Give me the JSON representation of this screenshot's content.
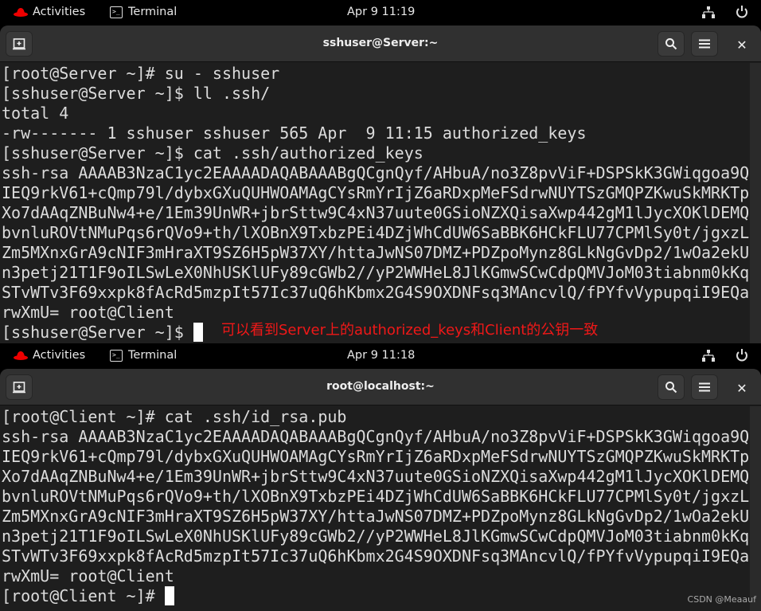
{
  "colors": {
    "annotation": "#f01818",
    "topbar": "#000000",
    "header": "#303030",
    "terminal_bg": "#1e1e1e"
  },
  "server": {
    "topbar": {
      "activities": "Activities",
      "app": "Terminal",
      "clock": "Apr 9  11:19"
    },
    "title": "sshuser@Server:~",
    "lines": [
      "[root@Server ~]# su - sshuser",
      "[sshuser@Server ~]$ ll .ssh/",
      "total 4",
      "-rw------- 1 sshuser sshuser 565 Apr  9 11:15 authorized_keys",
      "[sshuser@Server ~]$ cat .ssh/authorized_keys",
      "ssh-rsa AAAAB3NzaC1yc2EAAAADAQABAAABgQCgnQyf/AHbuA/no3Z8pvViF+DSPSkK3GWiqgoa9Q",
      "IEQ9rkV61+cQmp79l/dybxGXuQUHWOAMAgCYsRmYrIjZ6aRDxpMeFSdrwNUYTSzGMQPZKwuSkMRKTp",
      "Xo7dAAqZNBuNw4+e/1Em39UnWR+jbrSttw9C4xN37uute0GSioNZXQisaXwp442gM1lJycXOKlDEMQ",
      "bvnluROVtNMuPqs6rQVo9+th/lXOBnX9TxbzPEi4DZjWhCdUW6SaBBK6HCkFLU77CPMlSy0t/jgxzL",
      "Zm5MXnxGrA9cNIF3mHraXT9SZ6H5pW37XY/httaJwNS07DMZ+PDZpoMynz8GLkNgGvDp2/1wOa2ekU",
      "n3petj21T1F9oILSwLeX0NhUSKlUFy89cGWb2//yP2WWHeL8JlKGmwSCwCdpQMVJoM03tiabnm0kKq",
      "STvWTv3F69xxpk8fAcRd5mzpIt57Ic37uQ6hKbmx2G4S9OXDNFsq3MAncvlQ/fPYfvVypupqiI9EQa",
      "rwXmU= root@Client"
    ],
    "prompt": "[sshuser@Server ~]$ ",
    "annotation": "可以看到Server上的authorized_keys和Client的公钥一致"
  },
  "client": {
    "topbar": {
      "activities": "Activities",
      "app": "Terminal",
      "clock": "Apr 9  11:18"
    },
    "title": "root@localhost:~",
    "lines": [
      "[root@Client ~]# cat .ssh/id_rsa.pub",
      "ssh-rsa AAAAB3NzaC1yc2EAAAADAQABAAABgQCgnQyf/AHbuA/no3Z8pvViF+DSPSkK3GWiqgoa9Q",
      "IEQ9rkV61+cQmp79l/dybxGXuQUHWOAMAgCYsRmYrIjZ6aRDxpMeFSdrwNUYTSzGMQPZKwuSkMRKTp",
      "Xo7dAAqZNBuNw4+e/1Em39UnWR+jbrSttw9C4xN37uute0GSioNZXQisaXwp442gM1lJycXOKlDEMQ",
      "bvnluROVtNMuPqs6rQVo9+th/lXOBnX9TxbzPEi4DZjWhCdUW6SaBBK6HCkFLU77CPMlSy0t/jgxzL",
      "Zm5MXnxGrA9cNIF3mHraXT9SZ6H5pW37XY/httaJwNS07DMZ+PDZpoMynz8GLkNgGvDp2/1wOa2ekU",
      "n3petj21T1F9oILSwLeX0NhUSKlUFy89cGWb2//yP2WWHeL8JlKGmwSCwCdpQMVJoM03tiabnm0kKq",
      "STvWTv3F69xxpk8fAcRd5mzpIt57Ic37uQ6hKbmx2G4S9OXDNFsq3MAncvlQ/fPYfvVypupqiI9EQa",
      "rwXmU= root@Client"
    ],
    "prompt": "[root@Client ~]# "
  },
  "watermark": "CSDN @Meaauf"
}
